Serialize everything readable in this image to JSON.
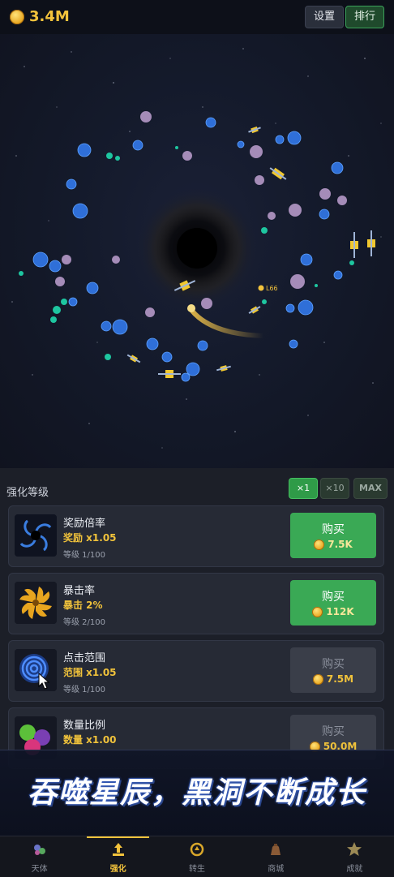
{
  "header": {
    "currency": "3.4M",
    "settings_label": "设置",
    "rank_label": "排行"
  },
  "game": {
    "player_level_tag": "L66"
  },
  "upgrades": {
    "title": "强化等级",
    "multipliers": [
      "×1",
      "×10",
      "MAX"
    ],
    "selected_multiplier": "×1",
    "items": [
      {
        "name": "奖励倍率",
        "effect": "奖励 x1.05",
        "level": "等级 1/100",
        "buy": "购买",
        "price": "7.5K",
        "affordable": true,
        "icon": "vortex-icon"
      },
      {
        "name": "暴击率",
        "effect": "暴击 2%",
        "level": "等级 2/100",
        "buy": "购买",
        "price": "112K",
        "affordable": true,
        "icon": "spiral-icon"
      },
      {
        "name": "点击范围",
        "effect": "范围 x1.05",
        "level": "等级 1/100",
        "buy": "购买",
        "price": "7.5M",
        "affordable": false,
        "icon": "cursor-swirl-icon"
      },
      {
        "name": "数量比例",
        "effect": "数量 x1.00",
        "level": "",
        "buy": "购买",
        "price": "50.0M",
        "affordable": false,
        "icon": "gems-icon"
      }
    ]
  },
  "banner": {
    "text": "吞噬星辰，黑洞不断成长"
  },
  "nav": {
    "items": [
      {
        "label": "天体",
        "icon": "planets-icon"
      },
      {
        "label": "强化",
        "icon": "upgrade-icon",
        "active": true
      },
      {
        "label": "转生",
        "icon": "rebirth-icon"
      },
      {
        "label": "商城",
        "icon": "shop-icon"
      },
      {
        "label": "成就",
        "icon": "star-icon"
      }
    ]
  },
  "colors": {
    "accent_gold": "#f3c33c",
    "buy_green": "#3aa955",
    "disabled_gray": "#3a3e49",
    "space_bg": "#141a2b"
  }
}
